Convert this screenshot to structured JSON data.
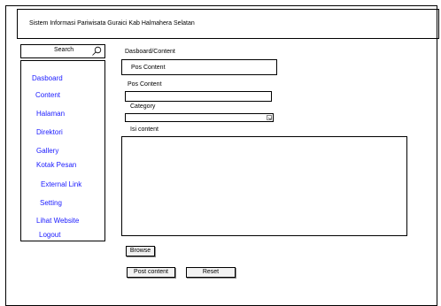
{
  "header": {
    "title": "Sistem Informasi Pariwisata Guraici Kab Halmahera Selatan"
  },
  "search": {
    "label": "Search",
    "icon": "search-icon"
  },
  "sidebar": {
    "items": [
      {
        "label": "Dasboard"
      },
      {
        "label": "Content"
      },
      {
        "label": "Halaman"
      },
      {
        "label": "Direktori"
      },
      {
        "label": "Gallery"
      },
      {
        "label": "Kotak Pesan"
      },
      {
        "label": "External Link"
      },
      {
        "label": "Setting"
      },
      {
        "label": "Lihat Website"
      },
      {
        "label": "Logout"
      }
    ]
  },
  "main": {
    "breadcrumb": "Dasboard/Content",
    "section_title": "Pos Content",
    "field_label": "Pos Content",
    "category_label": "Category",
    "content_label": "Isi content"
  },
  "buttons": {
    "browse": "Browse",
    "post": "Post content",
    "reset": "Reset"
  },
  "colors": {
    "link": "#1a1aff",
    "border": "#000000"
  }
}
